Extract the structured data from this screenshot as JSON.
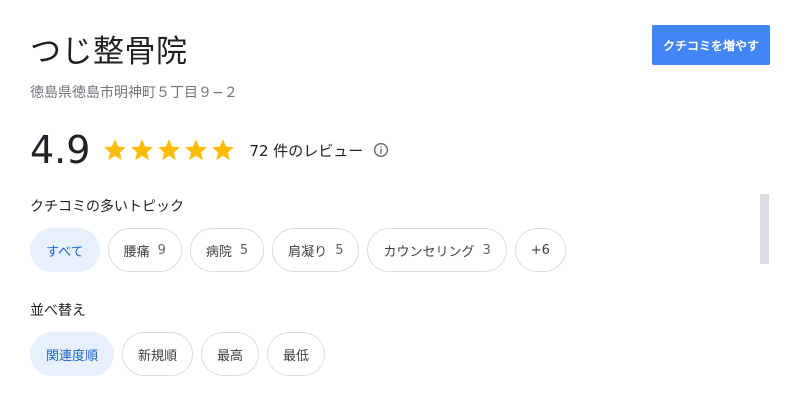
{
  "business": {
    "name": "つじ整骨院",
    "address": "徳島県徳島市明神町５丁目９−２"
  },
  "actions": {
    "add_review_label": "クチコミを増やす"
  },
  "rating": {
    "value": "4.9",
    "stars_out_of_5": 5,
    "review_count_label": "72 件のレビュー",
    "star_color": "#fbbc04"
  },
  "topics": {
    "label": "クチコミの多いトピック",
    "chips": [
      {
        "label": "すべて",
        "count": "",
        "selected": true
      },
      {
        "label": "腰痛",
        "count": "9",
        "selected": false
      },
      {
        "label": "病院",
        "count": "5",
        "selected": false
      },
      {
        "label": "肩凝り",
        "count": "5",
        "selected": false
      },
      {
        "label": "カウンセリング",
        "count": "3",
        "selected": false
      },
      {
        "label": "+6",
        "count": "",
        "selected": false
      }
    ]
  },
  "sort": {
    "label": "並べ替え",
    "chips": [
      {
        "label": "関連度順",
        "selected": true
      },
      {
        "label": "新規順",
        "selected": false
      },
      {
        "label": "最高",
        "selected": false
      },
      {
        "label": "最低",
        "selected": false
      }
    ]
  },
  "colors": {
    "accent": "#4285f4",
    "selected_chip_bg": "#e8f0fe",
    "selected_chip_text": "#1967d2"
  }
}
